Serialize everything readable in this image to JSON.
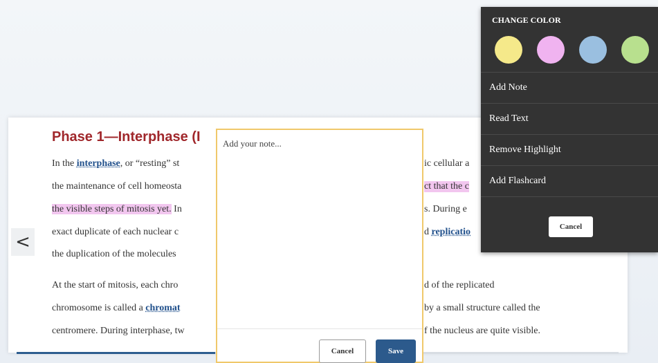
{
  "reader": {
    "heading": "Phase 1—Interphase (I",
    "para1": {
      "l1_a": "In the ",
      "l1_kw": "interphase",
      "l1_b": ", or “resting” st",
      "l1_r": "ic cellular a",
      "l2": "the maintenance of cell homeosta",
      "l2_r": "ct that the c",
      "l3_hl": "the visible steps of mitosis yet.",
      "l3_b": " In",
      "l3_r": "s. During e",
      "l4": "exact duplicate of each nuclear c",
      "l4_r_a": "d ",
      "l4_r_kw": "replicatio",
      "l5": "the duplication of the molecules"
    },
    "para2": {
      "l1": "At the start of mitosis, each chro",
      "l1_r": "d of the replicated",
      "l2_a": "chromosome is called a ",
      "l2_kw": "chromat",
      "l2_r": "by a small structure called the",
      "l3": "centromere. During interphase, tw",
      "l3_r": "f the nucleus are quite visible."
    },
    "progress": 0.33
  },
  "nav": {
    "prev_glyph": "<"
  },
  "note": {
    "placeholder": "Add your note...",
    "cancel_label": "Cancel",
    "save_label": "Save"
  },
  "menu": {
    "title": "CHANGE COLOR",
    "colors": [
      "#f5e98a",
      "#f0b3f0",
      "#9abfe0",
      "#b8e08e"
    ],
    "items": [
      "Add Note",
      "Read Text",
      "Remove Highlight",
      "Add Flashcard"
    ],
    "cancel_label": "Cancel"
  }
}
